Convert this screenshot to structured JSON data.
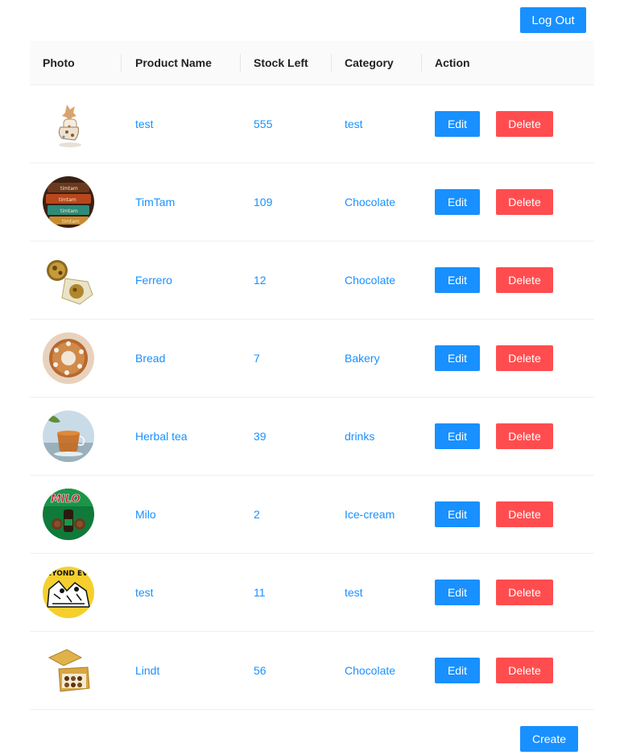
{
  "header": {
    "logout_label": "Log Out"
  },
  "table": {
    "columns": [
      "Photo",
      "Product Name",
      "Stock Left",
      "Category",
      "Action"
    ],
    "rows": [
      {
        "name": "test",
        "stock": "555",
        "category": "test",
        "photo": "figurine-photo"
      },
      {
        "name": "TimTam",
        "stock": "109",
        "category": "Chocolate",
        "photo": "timtam-packs-photo",
        "photo_text": "timtam"
      },
      {
        "name": "Ferrero",
        "stock": "12",
        "category": "Chocolate",
        "photo": "ferrero-chocolates-photo"
      },
      {
        "name": "Bread",
        "stock": "7",
        "category": "Bakery",
        "photo": "bread-ring-photo"
      },
      {
        "name": "Herbal tea",
        "stock": "39",
        "category": "drinks",
        "photo": "herbal-tea-cup-photo"
      },
      {
        "name": "Milo",
        "stock": "2",
        "category": "Ice-cream",
        "photo": "milo-icecream-photo",
        "photo_text": "MILO"
      },
      {
        "name": "test",
        "stock": "11",
        "category": "test",
        "photo": "beyond-sketch-photo",
        "photo_text": "BEYOND EVE"
      },
      {
        "name": "Lindt",
        "stock": "56",
        "category": "Chocolate",
        "photo": "lindt-box-photo"
      }
    ],
    "edit_label": "Edit",
    "delete_label": "Delete"
  },
  "footer": {
    "create_label": "Create"
  },
  "colors": {
    "primary": "#1890ff",
    "danger": "#ff4d4f",
    "header_bg": "#fafafa",
    "row_border": "#f0f0f0"
  }
}
